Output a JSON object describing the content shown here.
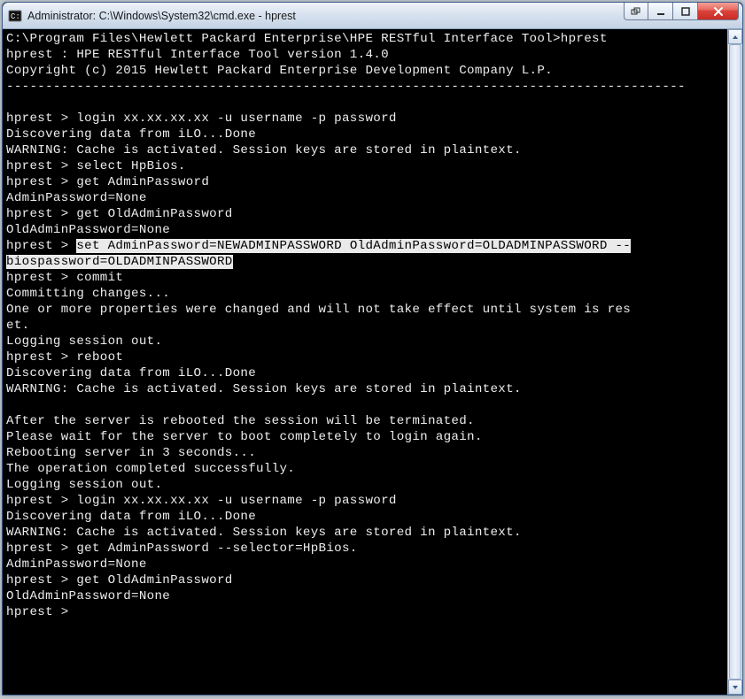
{
  "window": {
    "title": "Administrator: C:\\Windows\\System32\\cmd.exe - hprest"
  },
  "terminal": {
    "lines": [
      {
        "text": "C:\\Program Files\\Hewlett Packard Enterprise\\HPE RESTful Interface Tool>hprest"
      },
      {
        "text": "hprest : HPE RESTful Interface Tool version 1.4.0"
      },
      {
        "text": "Copyright (c) 2015 Hewlett Packard Enterprise Development Company L.P."
      },
      {
        "text": "---------------------------------------------------------------------------------------"
      },
      {
        "text": ""
      },
      {
        "text": "hprest > login xx.xx.xx.xx -u username -p password"
      },
      {
        "text": "Discovering data from iLO...Done"
      },
      {
        "text": "WARNING: Cache is activated. Session keys are stored in plaintext."
      },
      {
        "text": "hprest > select HpBios."
      },
      {
        "text": "hprest > get AdminPassword"
      },
      {
        "text": "AdminPassword=None"
      },
      {
        "text": "hprest > get OldAdminPassword"
      },
      {
        "text": "OldAdminPassword=None"
      },
      {
        "prefix": "hprest > ",
        "highlight": "set AdminPassword=NEWADMINPASSWORD OldAdminPassword=OLDADMINPASSWORD --"
      },
      {
        "highlight": "biospassword=OLDADMINPASSWORD"
      },
      {
        "text": "hprest > commit"
      },
      {
        "text": "Committing changes..."
      },
      {
        "text": "One or more properties were changed and will not take effect until system is res"
      },
      {
        "text": "et."
      },
      {
        "text": "Logging session out."
      },
      {
        "text": "hprest > reboot"
      },
      {
        "text": "Discovering data from iLO...Done"
      },
      {
        "text": "WARNING: Cache is activated. Session keys are stored in plaintext."
      },
      {
        "text": ""
      },
      {
        "text": "After the server is rebooted the session will be terminated."
      },
      {
        "text": "Please wait for the server to boot completely to login again."
      },
      {
        "text": "Rebooting server in 3 seconds..."
      },
      {
        "text": "The operation completed successfully."
      },
      {
        "text": "Logging session out."
      },
      {
        "text": "hprest > login xx.xx.xx.xx -u username -p password"
      },
      {
        "text": "Discovering data from iLO...Done"
      },
      {
        "text": "WARNING: Cache is activated. Session keys are stored in plaintext."
      },
      {
        "text": "hprest > get AdminPassword --selector=HpBios."
      },
      {
        "text": "AdminPassword=None"
      },
      {
        "text": "hprest > get OldAdminPassword"
      },
      {
        "text": "OldAdminPassword=None"
      },
      {
        "text": "hprest >"
      }
    ]
  }
}
